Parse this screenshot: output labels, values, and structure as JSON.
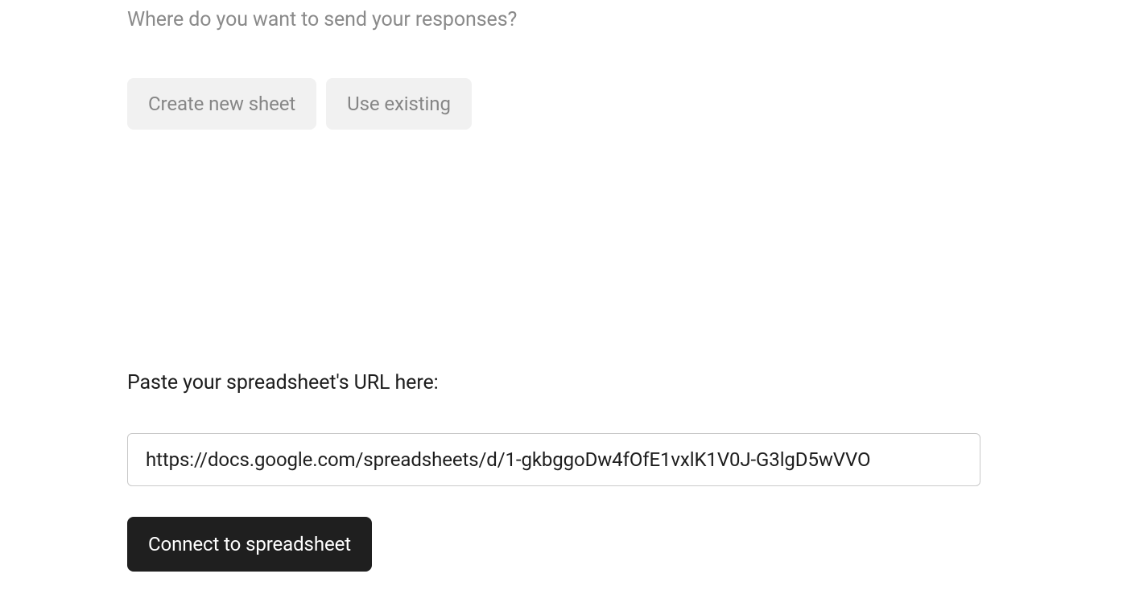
{
  "prompt": {
    "question": "Where do you want to send your responses?"
  },
  "options": {
    "create_new": "Create new sheet",
    "use_existing": "Use existing"
  },
  "url_section": {
    "label": "Paste your spreadsheet's URL here:",
    "input_value": "https://docs.google.com/spreadsheets/d/1-gkbggoDw4fOfE1vxlK1V0J-G3lgD5wVVO"
  },
  "actions": {
    "connect_label": "Connect to spreadsheet"
  }
}
